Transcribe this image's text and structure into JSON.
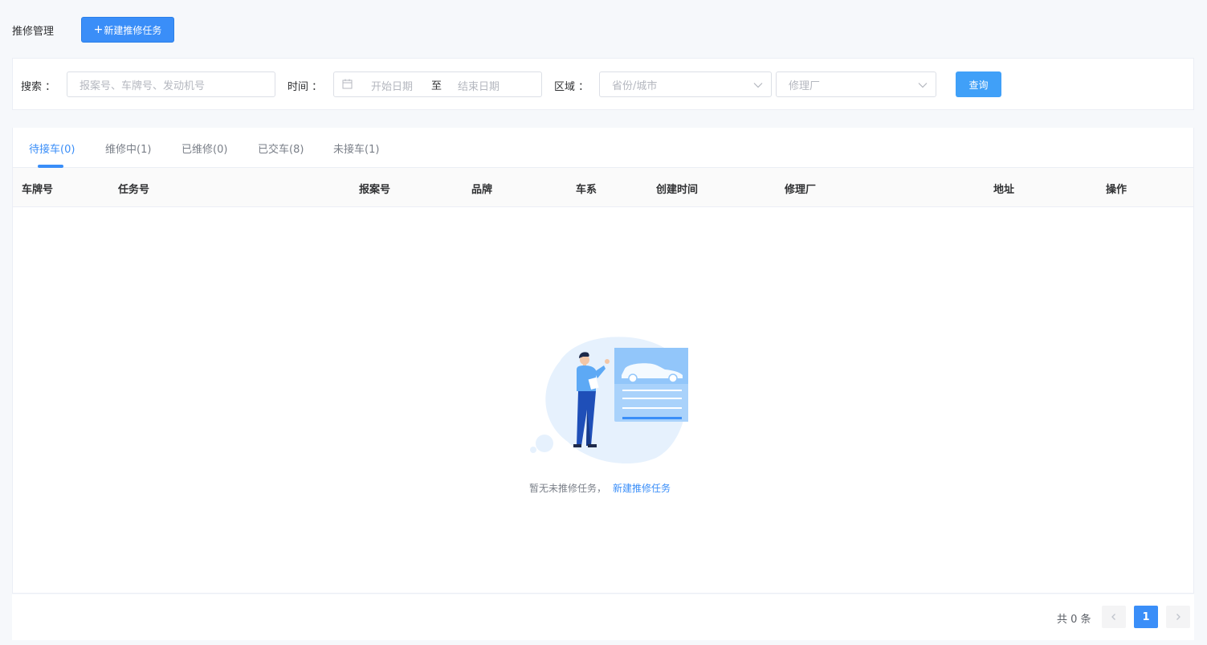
{
  "header": {
    "title": "推修管理",
    "new_task_plus": "+",
    "new_task_label": "新建推修任务"
  },
  "filters": {
    "search_label": "搜索 ：",
    "search_placeholder": "报案号、车牌号、发动机号",
    "time_label": "时间 ：",
    "start_placeholder": "开始日期",
    "range_separator": "至",
    "end_placeholder": "结束日期",
    "region_label": "区域 ：",
    "province_placeholder": "省份/城市",
    "factory_placeholder": "修理厂",
    "query_label": "查询"
  },
  "tabs": [
    {
      "label": "待接车(0)",
      "active": true
    },
    {
      "label": "维修中(1)",
      "active": false
    },
    {
      "label": "已维修(0)",
      "active": false
    },
    {
      "label": "已交车(8)",
      "active": false
    },
    {
      "label": "未接车(1)",
      "active": false
    }
  ],
  "table": {
    "columns": [
      "车牌号",
      "任务号",
      "报案号",
      "品牌",
      "车系",
      "创建时间",
      "修理厂",
      "地址",
      "操作"
    ],
    "rows": []
  },
  "empty": {
    "text": "暂无未推修任务，",
    "link": "新建推修任务",
    "icon": "empty-illustration-person-car-icon"
  },
  "pagination": {
    "total_text": "共 0 条",
    "current_page": "1",
    "prev_icon": "chevron-left-icon",
    "next_icon": "chevron-right-icon"
  },
  "colors": {
    "accent": "#3a8ef8",
    "query_button": "#40a0f8",
    "background": "#f6f8fb"
  }
}
